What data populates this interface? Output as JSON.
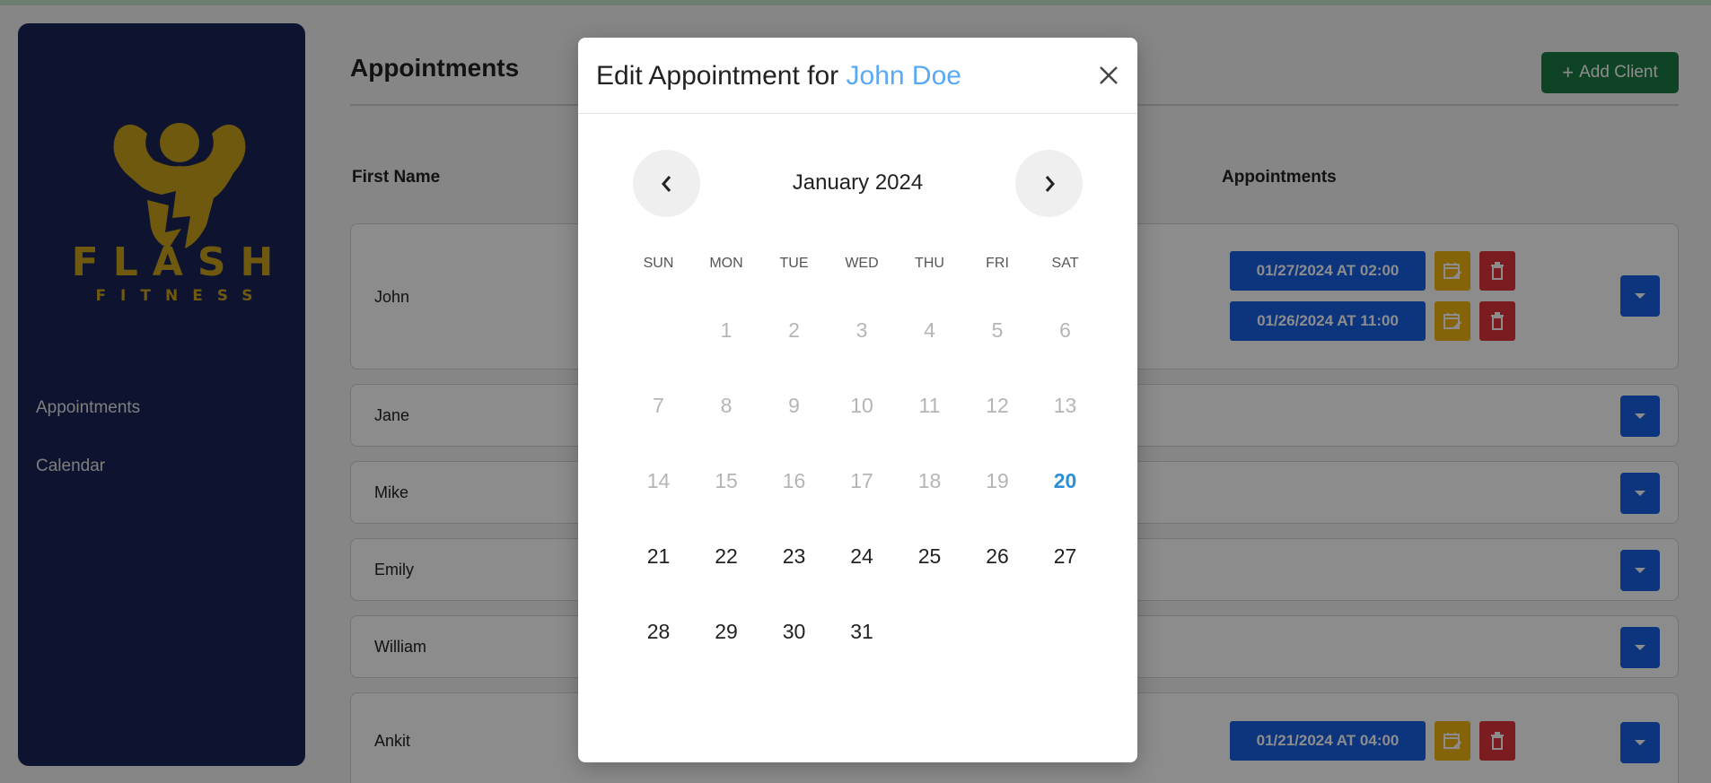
{
  "sidebar": {
    "logo_text_1": "FLASH",
    "logo_text_2": "FITNESS",
    "nav": [
      "Appointments",
      "Calendar"
    ]
  },
  "main": {
    "title": "Appointments",
    "add_client_label": "Add Client",
    "columns": {
      "first_name": "First Name",
      "appointments": "Appointments"
    },
    "rows": [
      {
        "name": "John",
        "appointments": [
          "01/27/2024 AT 02:00",
          "01/26/2024 AT 11:00"
        ]
      },
      {
        "name": "Jane",
        "appointments": []
      },
      {
        "name": "Mike",
        "appointments": []
      },
      {
        "name": "Emily",
        "appointments": []
      },
      {
        "name": "William",
        "appointments": []
      },
      {
        "name": "Ankit",
        "appointments": [
          "01/21/2024 AT 04:00"
        ]
      }
    ]
  },
  "modal": {
    "title_prefix": "Edit Appointment for",
    "client_name": "John Doe",
    "month_label": "January 2024",
    "weekdays": [
      "SUN",
      "MON",
      "TUE",
      "WED",
      "THU",
      "FRI",
      "SAT"
    ],
    "today": 20,
    "first_weekday_index": 1,
    "days_in_month": 31
  },
  "colors": {
    "sidebar_bg": "#1a2456",
    "logo_gold": "#c9a31c",
    "accent_blue": "#1662e6",
    "edit_yellow": "#f3b510",
    "delete_red": "#e0353b",
    "add_green": "#1d7a46",
    "client_name_blue": "#5aa9f5",
    "today_blue": "#2f8fd6"
  }
}
